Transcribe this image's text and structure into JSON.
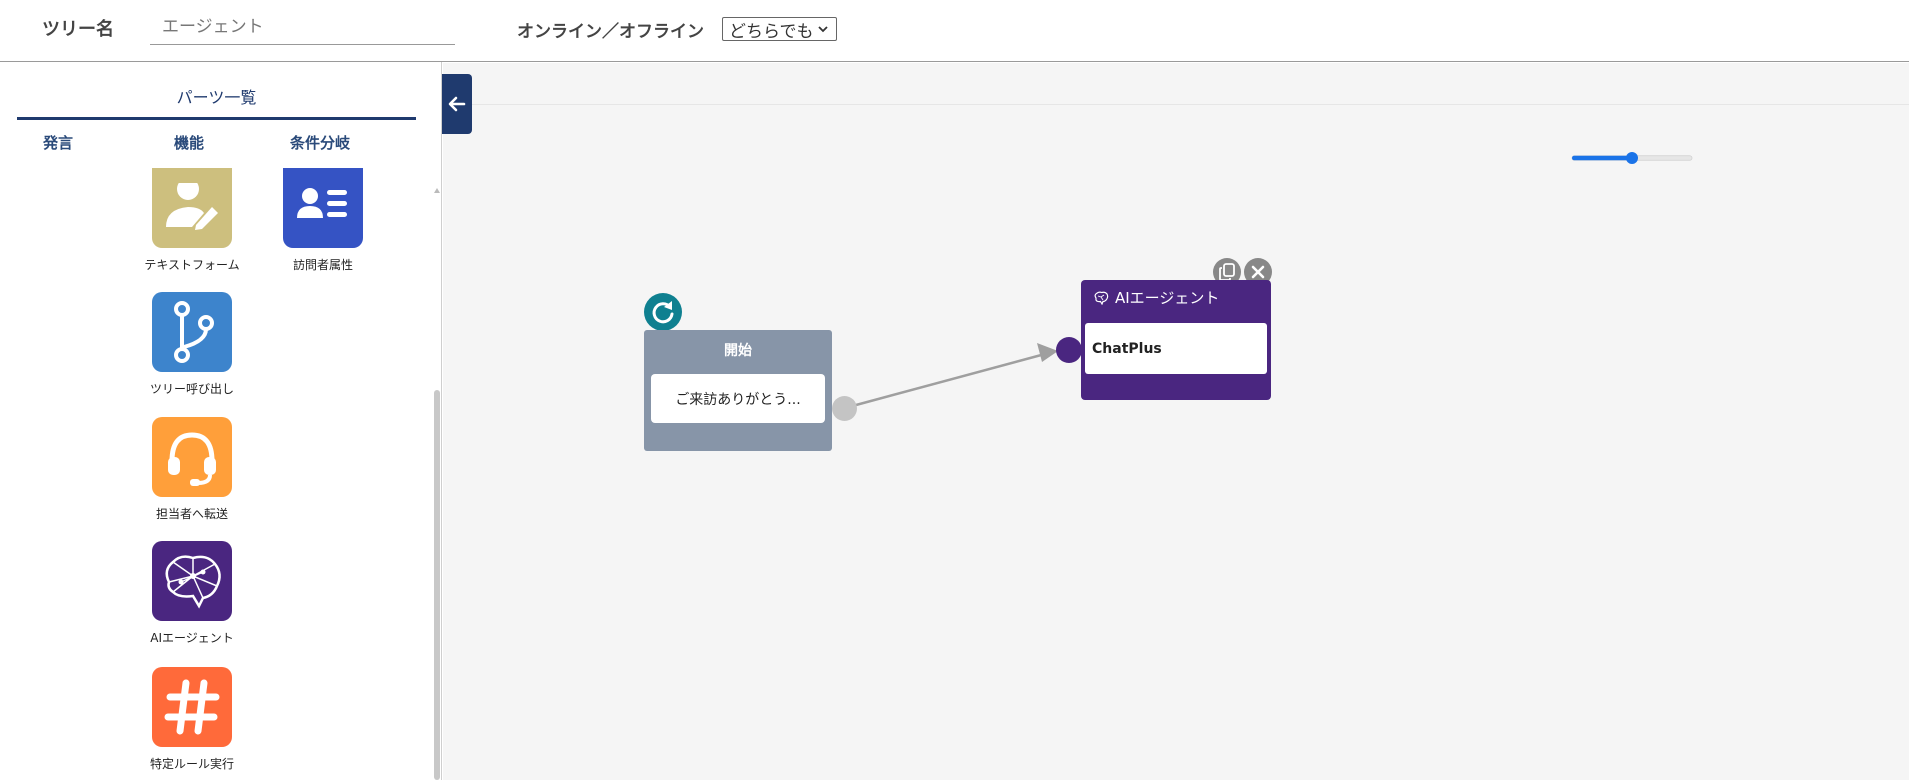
{
  "header": {
    "tree_name_label": "ツリー名",
    "tree_name_placeholder": "エージェント",
    "online_label": "オンライン／オフライン",
    "online_select_value": "どちらでも"
  },
  "sidebar": {
    "title": "パーツ一覧",
    "tabs": [
      "発言",
      "機能",
      "条件分岐"
    ],
    "parts": [
      {
        "label": "テキストフォーム",
        "icon": "text-form-icon",
        "color": "#cdbf7e"
      },
      {
        "label": "訪問者属性",
        "icon": "visitor-attribute-icon",
        "color": "#3553c4"
      },
      {
        "label": "ツリー呼び出し",
        "icon": "tree-call-icon",
        "color": "#3d84cc"
      },
      {
        "label": "担当者へ転送",
        "icon": "headset-icon",
        "color": "#ff9f3a"
      },
      {
        "label": "AIエージェント",
        "icon": "ai-brain-icon",
        "color": "#4a2680"
      },
      {
        "label": "特定ルール実行",
        "icon": "hash-icon",
        "color": "#ff6a3a"
      }
    ]
  },
  "canvas": {
    "zoom_value": 0.5,
    "start_node": {
      "title": "開始",
      "message": "ご来訪ありがとう..."
    },
    "ai_node": {
      "title": "AIエージェント",
      "body": "ChatPlus"
    }
  },
  "colors": {
    "navy": "#1f3a6e",
    "start_node": "#8795a8",
    "ai_node": "#4a2680",
    "reload": "#0f8090",
    "slider": "#1a73e8"
  }
}
